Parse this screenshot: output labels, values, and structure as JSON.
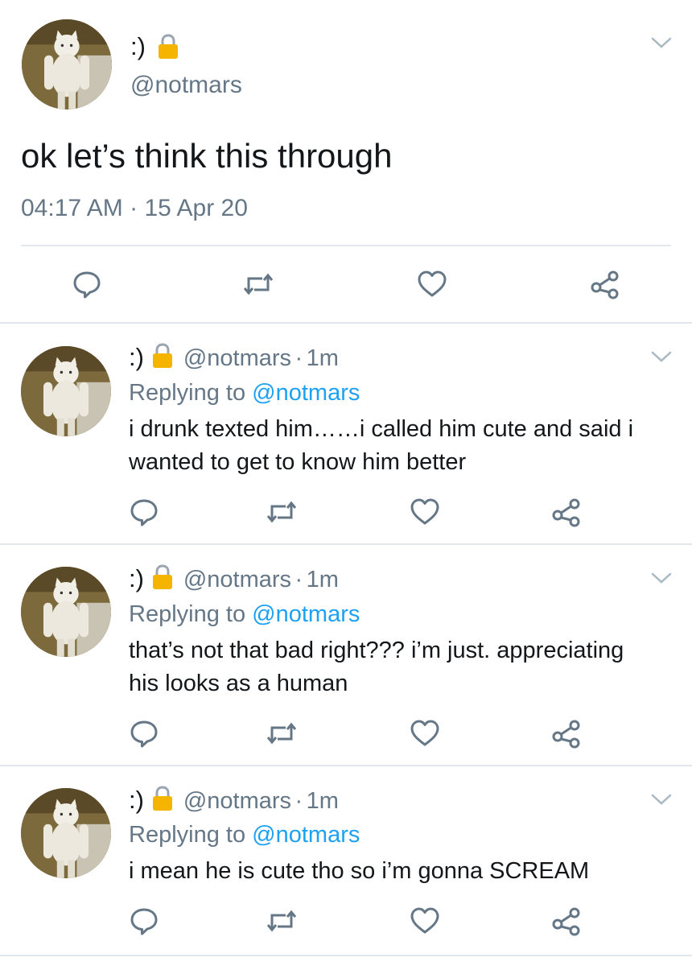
{
  "main_tweet": {
    "display_name": ":)",
    "handle": "@notmars",
    "text": "ok let’s think this through",
    "time": "04:17 AM",
    "separator": "·",
    "date": "15 Apr 20"
  },
  "replies": [
    {
      "display_name": ":)",
      "handle": "@notmars",
      "sep": "·",
      "age": "1m",
      "replying_prefix": "Replying to",
      "replying_handle": "@notmars",
      "line1": "i drunk texted him……i called him cute and said i",
      "line2": "wanted to get to know him better"
    },
    {
      "display_name": ":)",
      "handle": "@notmars",
      "sep": "·",
      "age": "1m",
      "replying_prefix": "Replying to",
      "replying_handle": "@notmars",
      "line1": "that’s not that bad right??? i’m just. appreciating",
      "line2": "his looks as a human"
    },
    {
      "display_name": ":)",
      "handle": "@notmars",
      "sep": "·",
      "age": "1m",
      "replying_prefix": "Replying to",
      "replying_handle": "@notmars",
      "line1": "i mean he is cute tho so i’m gonna SCREAM",
      "line2": ""
    }
  ],
  "icons": {
    "reply": "reply-icon",
    "retweet": "retweet-icon",
    "like": "heart-icon",
    "share": "share-icon",
    "lock": "lock-icon",
    "menu": "chevron-down-icon"
  },
  "colors": {
    "link": "#1da1f2",
    "muted": "#657786",
    "lock": "#f4b400",
    "divider": "#e1e8ed"
  }
}
